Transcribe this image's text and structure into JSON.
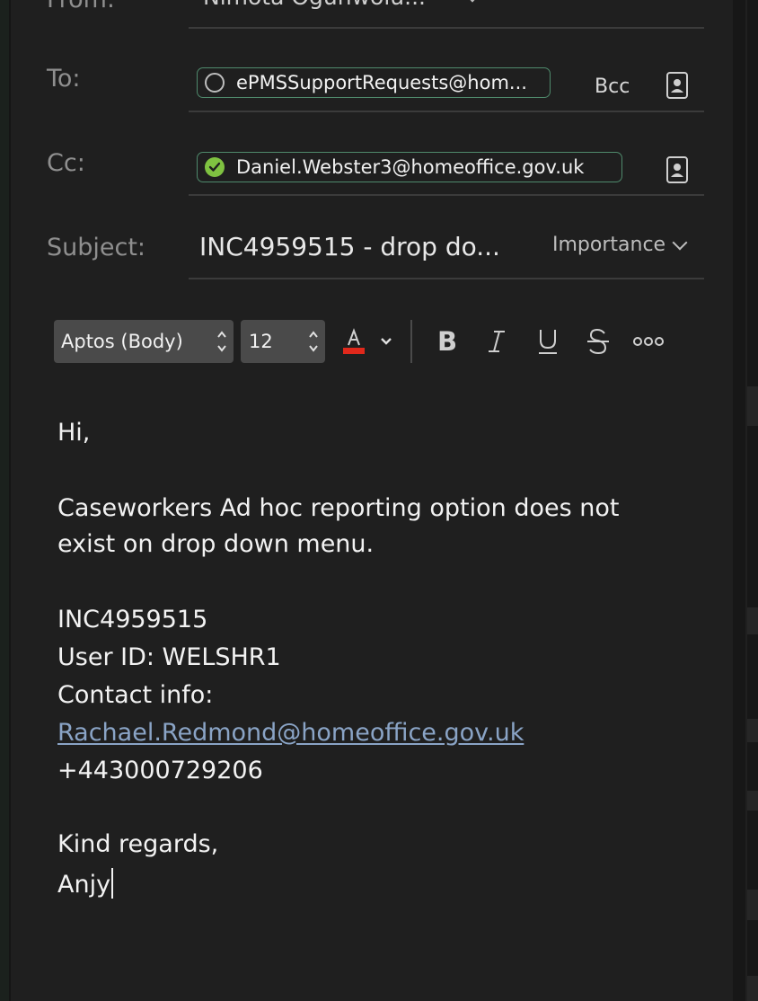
{
  "header": {
    "from_label": "From:",
    "from_value": "Nimota Ogunwolu..."
  },
  "to": {
    "label": "To:",
    "recipient": "ePMSSupportRequests@hom...",
    "bcc_label": "Bcc"
  },
  "cc": {
    "label": "Cc:",
    "recipient": "Daniel.Webster3@homeoffice.gov.uk"
  },
  "subject": {
    "label": "Subject:",
    "value": "INC4959515 -  drop do...",
    "importance_label": "Importance"
  },
  "toolbar": {
    "font_name": "Aptos (Body)",
    "font_size": "12",
    "font_color": "#e0281b",
    "bold": "B",
    "italic": "I",
    "underline": "U",
    "strikethrough": "S"
  },
  "body": {
    "greeting": "Hi,",
    "line1": "Caseworkers Ad hoc reporting option does not",
    "line2": "exist on drop down menu.",
    "incident": "INC4959515",
    "user_id": "User ID: WELSHR1",
    "contact_label": "Contact info:",
    "contact_email": "Rachael.Redmond@homeoffice.gov.uk",
    "phone": "+443000729206",
    "signoff": "Kind regards,",
    "name": "Anjy"
  }
}
